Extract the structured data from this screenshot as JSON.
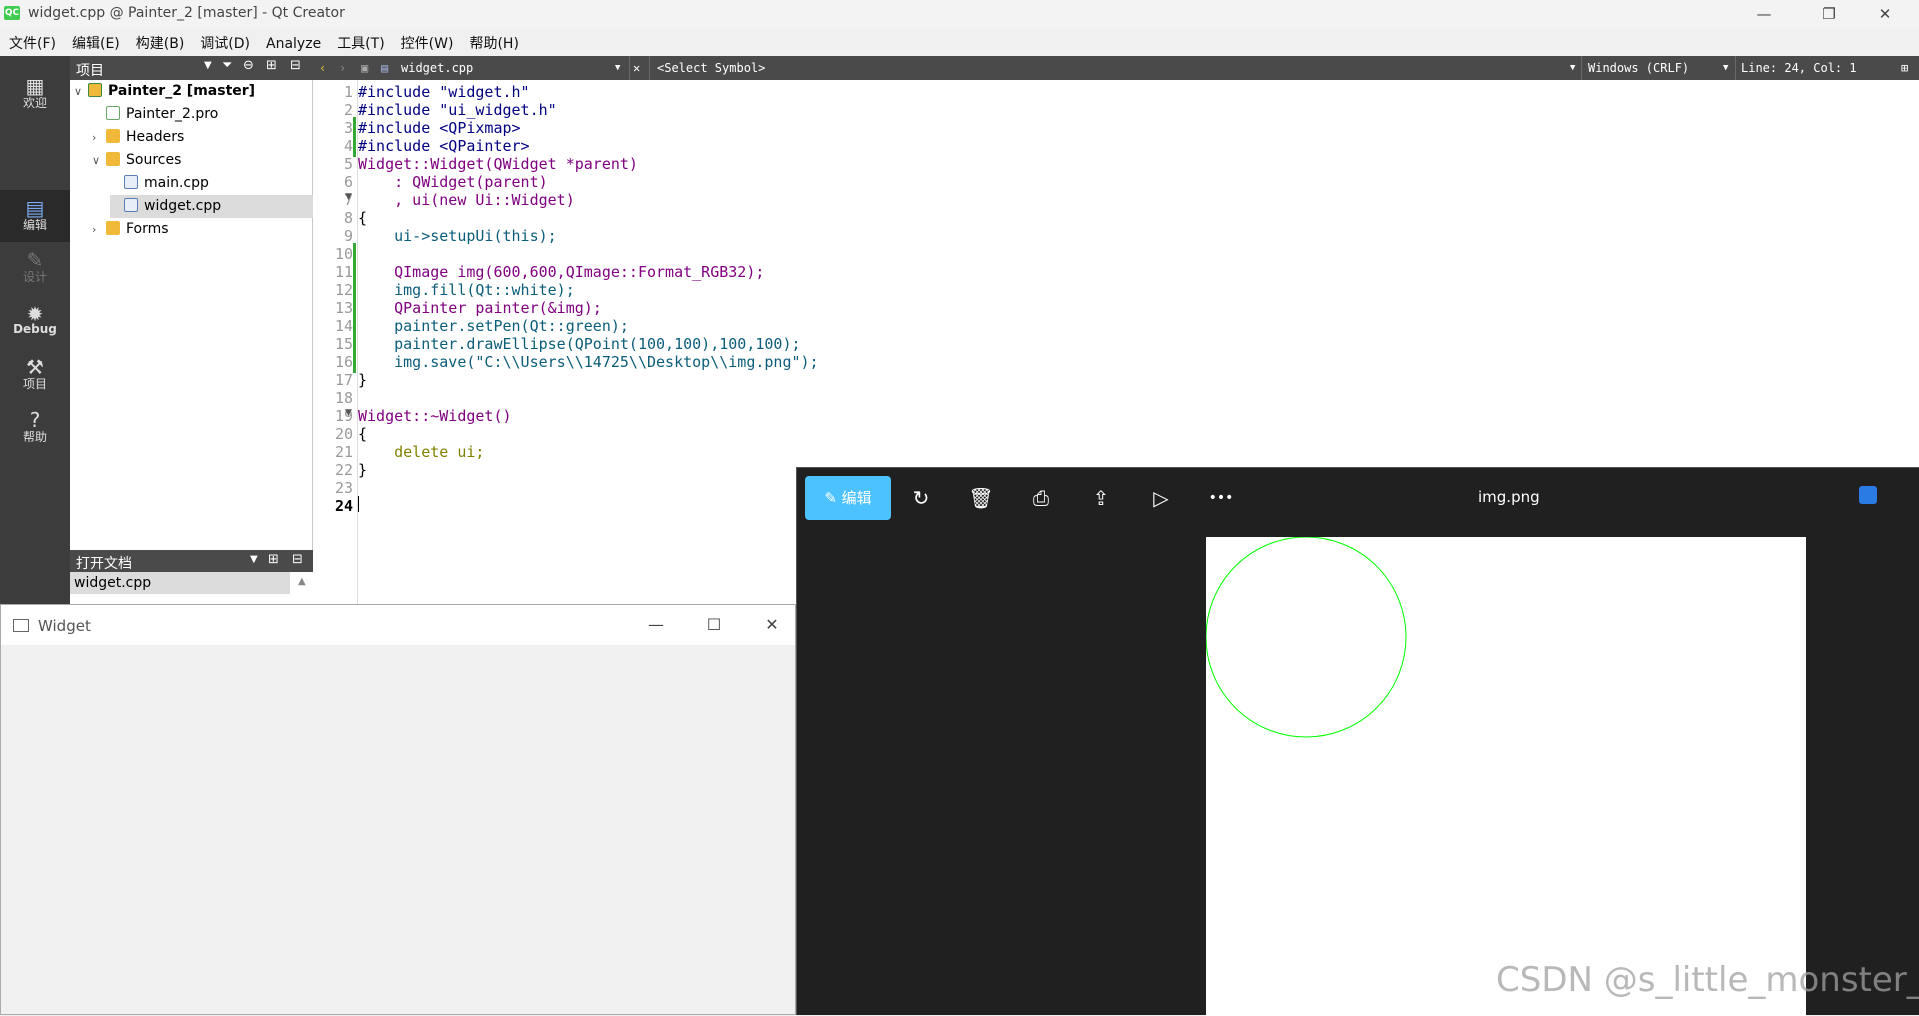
{
  "window": {
    "title": "widget.cpp @ Painter_2 [master] - Qt Creator",
    "app_icon_label": "QC",
    "minimize": "—",
    "restore": "❐",
    "close": "✕"
  },
  "menubar": [
    "文件(F)",
    "编辑(E)",
    "构建(B)",
    "调试(D)",
    "Analyze",
    "工具(T)",
    "控件(W)",
    "帮助(H)"
  ],
  "modes": [
    {
      "label": "欢迎",
      "icon": "grid-icon"
    },
    {
      "label": "编辑",
      "icon": "edit-icon"
    },
    {
      "label": "设计",
      "icon": "design-icon"
    },
    {
      "label": "Debug",
      "icon": "bug-icon"
    },
    {
      "label": "项目",
      "icon": "wrench-icon"
    },
    {
      "label": "帮助",
      "icon": "help-icon"
    }
  ],
  "project_panel": {
    "header": "项目",
    "tree": [
      {
        "label": "Painter_2 [master]",
        "depth": 0,
        "expanded": true,
        "bold": true,
        "kind": "project"
      },
      {
        "label": "Painter_2.pro",
        "depth": 1,
        "kind": "pro"
      },
      {
        "label": "Headers",
        "depth": 1,
        "expanded": false,
        "kind": "folder"
      },
      {
        "label": "Sources",
        "depth": 1,
        "expanded": true,
        "kind": "folder"
      },
      {
        "label": "main.cpp",
        "depth": 2,
        "kind": "cpp"
      },
      {
        "label": "widget.cpp",
        "depth": 2,
        "kind": "cpp",
        "selected": true
      },
      {
        "label": "Forms",
        "depth": 1,
        "expanded": false,
        "kind": "folder"
      }
    ]
  },
  "open_documents": {
    "header": "打开文档",
    "items": [
      "widget.cpp"
    ]
  },
  "editor_toolbar": {
    "file": "widget.cpp",
    "symbol": "<Select Symbol>",
    "line_ending": "Windows (CRLF)",
    "position": "Line: 24, Col: 1"
  },
  "editor": {
    "line_numbers": [
      "1",
      "2",
      "3",
      "4",
      "5",
      "6",
      "7",
      "8",
      "9",
      "10",
      "11",
      "12",
      "13",
      "14",
      "15",
      "16",
      "17",
      "18",
      "19",
      "20",
      "21",
      "22",
      "23",
      "24"
    ],
    "lines": [
      "#include \"widget.h\"",
      "#include \"ui_widget.h\"",
      "#include <QPixmap>",
      "#include <QPainter>",
      "Widget::Widget(QWidget *parent)",
      "    : QWidget(parent)",
      "    , ui(new Ui::Widget)",
      "{",
      "    ui->setupUi(this);",
      "",
      "    QImage img(600,600,QImage::Format_RGB32);",
      "    img.fill(Qt::white);",
      "    QPainter painter(&img);",
      "    painter.setPen(Qt::green);",
      "    painter.drawEllipse(QPoint(100,100),100,100);",
      "    img.save(\"C:\\\\Users\\\\14725\\\\Desktop\\\\img.png\");",
      "}",
      "",
      "Widget::~Widget()",
      "{",
      "    delete ui;",
      "}",
      "",
      ""
    ]
  },
  "widget_window": {
    "title": "Widget",
    "minimize": "—",
    "maximize": "☐",
    "close": "✕"
  },
  "photo_viewer": {
    "edit_label": "编辑",
    "filename": "img.png",
    "tools": [
      "rotate-icon",
      "delete-icon",
      "print-icon",
      "share-icon",
      "slideshow-icon",
      "more-icon"
    ],
    "more_label": "•••",
    "circle_color": "#00ff00"
  },
  "watermark": "CSDN @s_little_monster_"
}
